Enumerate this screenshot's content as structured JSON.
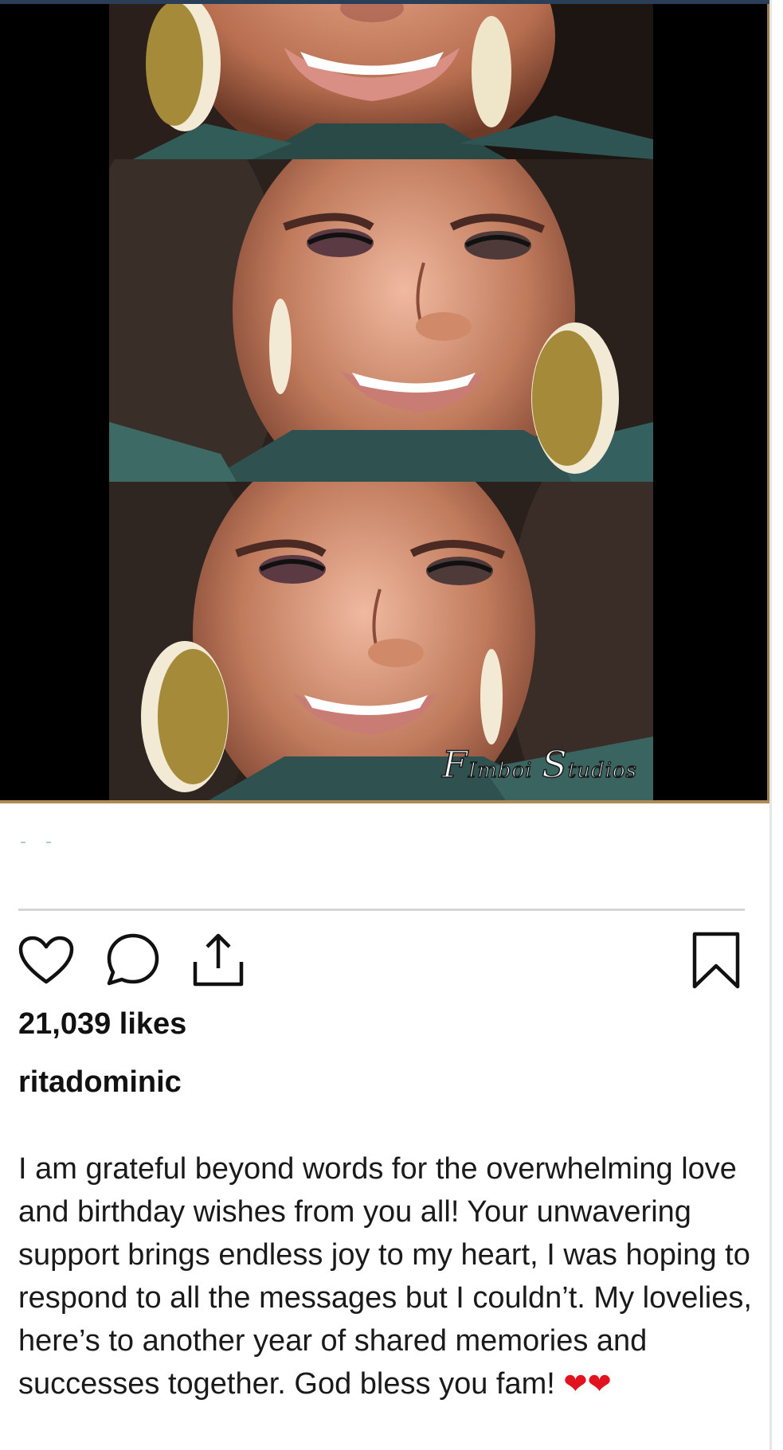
{
  "post": {
    "watermark": {
      "first_initial": "F",
      "first_rest": "Imboi",
      "second_initial": "S",
      "second_rest": "tudios"
    },
    "likes_text": "21,039 likes",
    "username": "ritadominic",
    "caption": "I am grateful beyond words for the overwhelming love and birthday wishes from you all! Your unwavering support brings endless joy to my heart, I was hoping to respond to all the messages but I couldn’t. My lovelies, here’s to another year of shared memories and successes together. God bless you fam!",
    "caption_emoji": "❤❤"
  },
  "actions": {
    "like_icon": "heart-icon",
    "comment_icon": "comment-bubble-icon",
    "share_icon": "share-upload-icon",
    "save_icon": "bookmark-icon"
  },
  "colors": {
    "text": "#111111",
    "heart_emoji": "#e0131f",
    "divider": "#d6d6d6",
    "media_background": "#000000",
    "media_border": "#b08a55"
  }
}
